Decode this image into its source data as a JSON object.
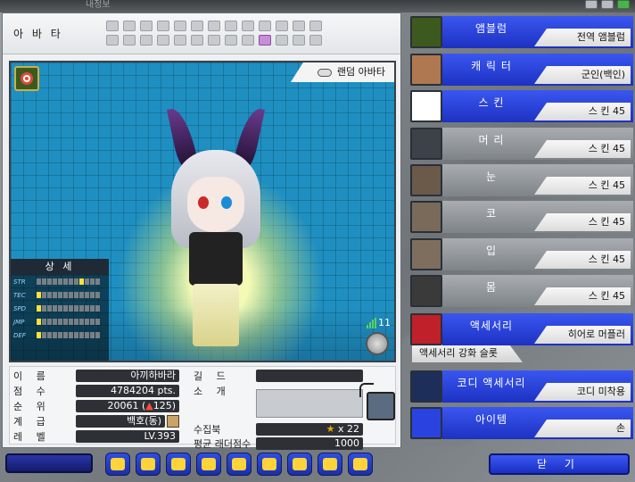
{
  "window": {
    "title": "내정보"
  },
  "avatar": {
    "header_label": "아 바 타",
    "random_avatar_label": "랜덤 아바타",
    "details_title": "상 세",
    "stats": [
      {
        "name": "STR",
        "level": 8
      },
      {
        "name": "TEC",
        "level": 0
      },
      {
        "name": "SPD",
        "level": 0
      },
      {
        "name": "JMP",
        "level": 0
      },
      {
        "name": "DEF",
        "level": 0
      }
    ],
    "signal_count": "11"
  },
  "profile": {
    "name_label": "이 름",
    "name_value": "아끼하바라",
    "score_label": "점 수",
    "score_value": "4784204 pts.",
    "rank_label": "순 위",
    "rank_value": "20061 (",
    "rank_change": "125",
    "rank_suffix": ")",
    "class_label": "계 급",
    "class_value": "백호(동)",
    "level_label": "레 벨",
    "level_value": "LV.393",
    "guild_label": "길 드",
    "intro_label": "소 개",
    "collection_label": "수집북",
    "collection_value": "x 22",
    "ladder_label": "평균 래더점수",
    "ladder_value": "1000"
  },
  "equipment": [
    {
      "name": "앰블럼",
      "value": "전역 앰블럼",
      "icon": "emblem-icon",
      "style": "blue"
    },
    {
      "name": "캐 릭 터",
      "value": "군인(백인)",
      "icon": "character-icon",
      "style": "blue"
    },
    {
      "name": "스   킨",
      "value": "스   킨 45",
      "icon": "skin-icon",
      "style": "blue"
    },
    {
      "name": "머   리",
      "value": "스   킨 45",
      "icon": "hair-icon",
      "style": "gray"
    },
    {
      "name": "눈",
      "value": "스   킨 45",
      "icon": "eyes-icon",
      "style": "gray"
    },
    {
      "name": "코",
      "value": "스   킨 45",
      "icon": "nose-icon",
      "style": "gray"
    },
    {
      "name": "입",
      "value": "스   킨 45",
      "icon": "mouth-icon",
      "style": "gray"
    },
    {
      "name": "몸",
      "value": "스   킨 45",
      "icon": "body-icon",
      "style": "gray"
    },
    {
      "name": "액세서리",
      "value": "히어로 머플러",
      "icon": "accessory-icon",
      "style": "blue"
    },
    {
      "name": "코디 액세서리",
      "value": "코디 미착용",
      "icon": "codi-accessory-icon",
      "style": "blue"
    },
    {
      "name": "아이템",
      "value": "손",
      "icon": "hand-icon",
      "style": "blue"
    }
  ],
  "accessory_slot_label": "액세서리 강화 슬롯",
  "close_label": "닫 기",
  "colors": {
    "accent_blue": "#2a43e0",
    "grid_blue": "#1f8fc1",
    "star": "#e6a800"
  }
}
